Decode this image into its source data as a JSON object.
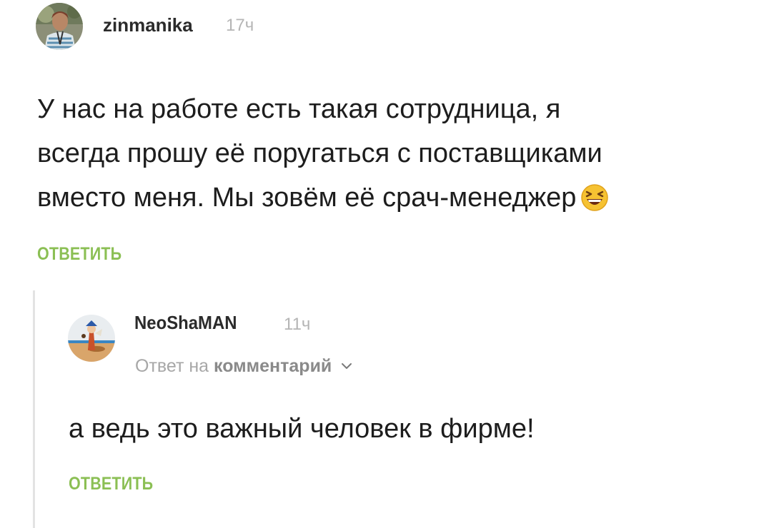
{
  "comment": {
    "username": "zinmanika",
    "time": "17ч",
    "text_lines": [
      "У нас на работе есть такая сотрудница, я",
      "всегда прошу её поругаться с поставщиками",
      "вместо меня. Мы зовём её срач-менеджер"
    ],
    "emoji": "laughing-face-emoji",
    "reply_label": "ОТВЕТИТЬ"
  },
  "reply": {
    "username": "NeoShaMAN",
    "time": "11ч",
    "meta_prefix": "Ответ на",
    "meta_link": "комментарий",
    "text": "а ведь это важный человек в фирме!",
    "reply_label": "ОТВЕТИТЬ"
  },
  "colors": {
    "accent_green": "#8bbf54",
    "muted_gray": "#b5b5b5",
    "thread_line": "#e3e3e3"
  }
}
